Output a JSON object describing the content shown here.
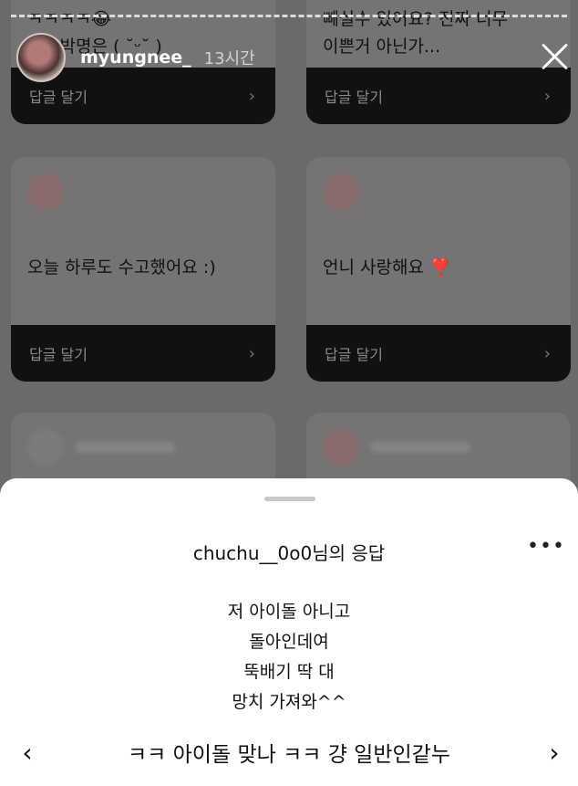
{
  "story": {
    "username": "myungnee_",
    "time_ago": "13시간",
    "cards": [
      {
        "message_lines": [
          "ㅋㅋㅋㅋ😂",
          "해 박명은 ( ˘ᵕ˘ )"
        ],
        "reply_label": "답글 달기"
      },
      {
        "message_lines": [
          "빼실수 있어요? 진짜 너무",
          "이쁜거 아닌가..."
        ],
        "reply_label": "답글 달기"
      },
      {
        "message_lines": [
          "오늘 하루도 수고했어요 :)"
        ],
        "reply_label": "답글 달기"
      },
      {
        "message_lines": [
          "언니 사랑해요 ❣️"
        ],
        "reply_label": "답글 달기"
      }
    ]
  },
  "sheet": {
    "title": "chuchu__0o0님의 응답",
    "more_icon": "more-horizontal-icon",
    "response_lines": [
      "저 아이돌 아니고",
      "돌아인데여",
      "뚝배기 딱 대",
      "망치 가져와^^"
    ],
    "caption": "ㅋㅋ 아이돌 맞나 ㅋㅋ 걍 일반인같누"
  }
}
